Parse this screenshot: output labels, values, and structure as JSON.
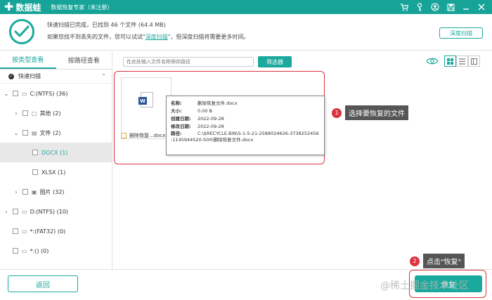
{
  "titlebar": {
    "logo_mark": "✚",
    "logo_text": "数据蛙",
    "title": "数据恢复专家（未注册）",
    "controls": [
      "cart-icon",
      "key-icon",
      "user-icon",
      "save-icon",
      "minimize-icon",
      "close-icon"
    ]
  },
  "status": {
    "line1": "快速扫描已完成，已找到 46 个文件 (64.4 MB)",
    "line2_prefix": "如果您找不到丢失的文件，您可以试试\"",
    "deep_link": "深度扫描",
    "line2_suffix": "\"，但深度扫描将需要更多时间。",
    "deep_scan_button": "深度扫描"
  },
  "left_panel": {
    "tabs": [
      {
        "label": "按类型查看",
        "active": true
      },
      {
        "label": "按路径查看",
        "active": false
      }
    ],
    "quick_scan": "快速扫描",
    "tree": [
      {
        "label": "C:(NTFS) (36)",
        "indent": 0,
        "toggle": "⌄",
        "icon": "drive-icon"
      },
      {
        "label": "其他 (2)",
        "indent": 1,
        "toggle": "›",
        "icon": "folder-icon"
      },
      {
        "label": "文件 (2)",
        "indent": 1,
        "toggle": "⌄",
        "icon": "document-icon"
      },
      {
        "label": "DOCX (1)",
        "indent": 2,
        "toggle": "",
        "icon": "",
        "selected": true
      },
      {
        "label": "XLSX (1)",
        "indent": 2,
        "toggle": "",
        "icon": ""
      },
      {
        "label": "图片 (32)",
        "indent": 1,
        "toggle": "›",
        "icon": "image-icon"
      },
      {
        "label": "D:(NTFS) (10)",
        "indent": 0,
        "toggle": "›",
        "icon": "drive-icon"
      },
      {
        "label": "*:(FAT32) (0)",
        "indent": 0,
        "toggle": "",
        "icon": "drive-icon"
      },
      {
        "label": "*:() (0)",
        "indent": 0,
        "toggle": "",
        "icon": "drive-icon"
      }
    ]
  },
  "toolbar": {
    "search_placeholder": "在此处输入文件名称保存路径",
    "filter_button": "筛选器"
  },
  "file": {
    "name": "删除恢复...docx",
    "tooltip": {
      "name_key": "名称:",
      "name_val": "删除恢复文件.docx",
      "size_key": "大小:",
      "size_val": "0.00 B",
      "created_key": "创建日期:",
      "created_val": "2022-09-28",
      "modified_key": "修改日期:",
      "modified_val": "2022-09-28",
      "path_key": "路径:",
      "path_val": "C:\\$RECYCLE.BIN\\S-1-5-21-2588024626-3738252456-1145944520-500\\删除恢复文件.docx"
    }
  },
  "annotations": {
    "a1_num": "1",
    "a1_text": "选择要恢复的文件",
    "a2_num": "2",
    "a2_text": "点击\"恢复\""
  },
  "bottom": {
    "back_button": "返回",
    "recover_button": "恢复",
    "watermark": "@稀土掘金技术社区"
  },
  "colors": {
    "brand": "#1aa99c",
    "highlight": "#d9343f"
  }
}
